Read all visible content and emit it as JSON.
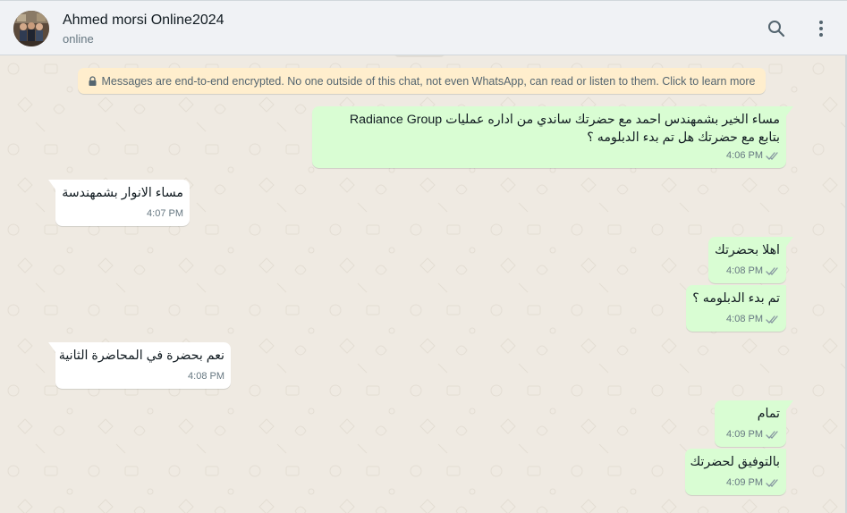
{
  "header": {
    "contact_name": "Ahmed morsi Online2024",
    "status": "online",
    "icons": [
      "search-icon",
      "menu-icon"
    ]
  },
  "encryption_notice": "Messages are end-to-end encrypted. No one outside of this chat, not even WhatsApp, can read or listen to them. Click to learn more",
  "messages": [
    {
      "direction": "out",
      "lines": [
        "مساء الخير بشمهندس احمد مع حضرتك ساندي من اداره عمليات Radiance Group",
        "بتابع مع حضرتك هل تم بدء الدبلومه ؟"
      ],
      "time": "4:06 PM",
      "status": "read"
    },
    {
      "direction": "in",
      "lines": [
        "مساء الانوار بشمهندسة"
      ],
      "time": "4:07 PM"
    },
    {
      "direction": "out",
      "lines": [
        "اهلا بحضرتك"
      ],
      "time": "4:08 PM",
      "status": "read"
    },
    {
      "direction": "out",
      "lines": [
        "تم بدء الدبلومه ؟"
      ],
      "time": "4:08 PM",
      "status": "read"
    },
    {
      "direction": "in",
      "lines": [
        "نعم بحضرة في المحاضرة الثانية"
      ],
      "time": "4:08 PM"
    },
    {
      "direction": "out",
      "lines": [
        "تمام"
      ],
      "time": "4:09 PM",
      "status": "read"
    },
    {
      "direction": "out",
      "lines": [
        "بالتوفيق لحضرتك"
      ],
      "time": "4:09 PM",
      "status": "read"
    }
  ],
  "colors": {
    "outgoing_bubble": "#d9fdd3",
    "incoming_bubble": "#ffffff",
    "encryption_bg": "#ffeecd",
    "chat_bg": "#efeae2",
    "read_ticks": "#8696a0"
  }
}
